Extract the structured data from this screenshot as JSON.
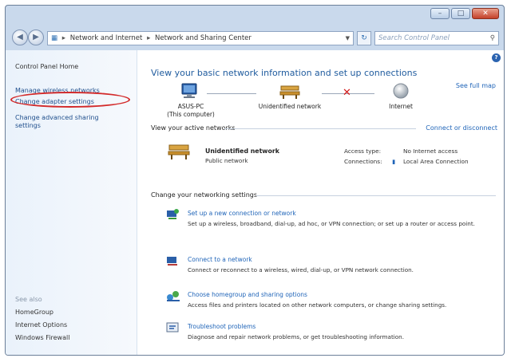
{
  "window": {
    "buttons": {
      "minimize": "–",
      "maximize": "□",
      "close": "✕"
    }
  },
  "nav": {
    "back": "◀",
    "forward": "▶",
    "address": {
      "level1": "Network and Internet",
      "level2": "Network and Sharing Center",
      "separator": "▸"
    },
    "search_placeholder": "Search Control Panel"
  },
  "sidebar": {
    "home": "Control Panel Home",
    "items": [
      {
        "label": "Manage wireless networks"
      },
      {
        "label": "Change adapter settings"
      },
      {
        "label": "Change advanced sharing"
      },
      {
        "label": "settings"
      }
    ],
    "see_also": "See also",
    "see_also_items": [
      {
        "label": "HomeGroup"
      },
      {
        "label": "Internet Options"
      },
      {
        "label": "Windows Firewall"
      }
    ]
  },
  "main": {
    "title": "View your basic network information and set up connections",
    "see_full_map": "See full map",
    "map": {
      "computer": "ASUS-PC",
      "computer_sub": "(This computer)",
      "network": "Unidentified network",
      "internet": "Internet"
    },
    "active_header": "View your active networks",
    "connect_disconnect": "Connect or disconnect",
    "active_network": {
      "name": "Unidentified network",
      "type": "Public network",
      "access_type_label": "Access type:",
      "access_type_value": "No Internet access",
      "connections_label": "Connections:",
      "connections_value": "Local Area Connection"
    },
    "change_header": "Change your networking settings",
    "tasks": [
      {
        "title": "Set up a new connection or network",
        "desc": "Set up a wireless, broadband, dial-up, ad hoc, or VPN connection; or set up a router or access point."
      },
      {
        "title": "Connect to a network",
        "desc": "Connect or reconnect to a wireless, wired, dial-up, or VPN network connection."
      },
      {
        "title": "Choose homegroup and sharing options",
        "desc": "Access files and printers located on other network computers, or change sharing settings."
      },
      {
        "title": "Troubleshoot problems",
        "desc": "Diagnose and repair network problems, or get troubleshooting information."
      }
    ]
  },
  "colors": {
    "accent_link": "#1f64b8",
    "highlight_oval": "#d32a2a",
    "no_connection_x": "#d41a1a"
  }
}
